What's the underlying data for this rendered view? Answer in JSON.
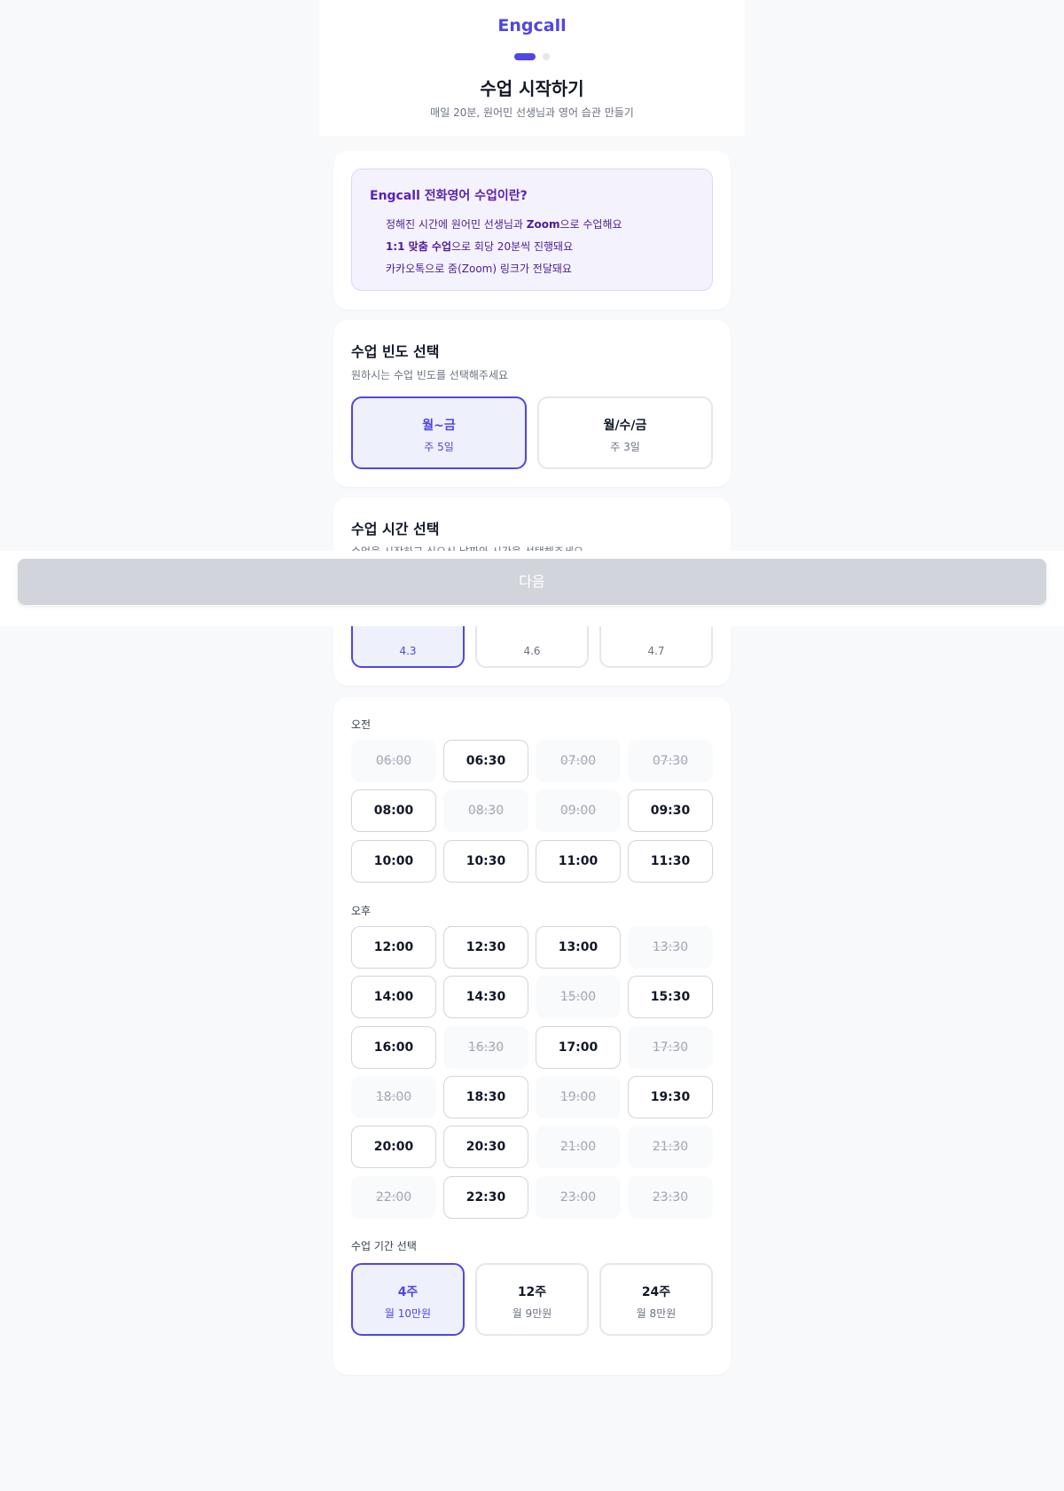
{
  "header": {
    "logo": "Engcall",
    "title": "수업 시작하기",
    "subtitle": "매일 20분, 원어민 선생님과 영어 습관 만들기"
  },
  "info": {
    "title": "Engcall 전화영어 수업이란?",
    "line1_pre": "정해진 시간에 원어민 선생님과 ",
    "line1_bold": "Zoom",
    "line1_post": "으로 수업해요",
    "line2_bold": "1:1 맞춤 수업",
    "line2_post": "으로 회당 20분씩 진행돼요",
    "line3": "카카오톡으로 줌(Zoom) 링크가 전달돼요"
  },
  "frequency": {
    "title": "수업 빈도 선택",
    "subtitle": "원하시는 수업 빈도를 선택해주세요",
    "options": [
      {
        "label": "월~금",
        "sub": "주 5일"
      },
      {
        "label": "월/수/금",
        "sub": "주 3일"
      }
    ]
  },
  "time_select": {
    "title": "수업 시간 선택",
    "subtitle": "수업을 시작하고 싶으신 날짜와 시간을 선택해주세요",
    "dates": [
      "4.3",
      "4.6",
      "4.7"
    ]
  },
  "next_button": "다음",
  "slots": {
    "am_label": "오전",
    "am": [
      "06:00",
      "06:30",
      "07:00",
      "07:30",
      "08:00",
      "08:30",
      "09:00",
      "09:30",
      "10:00",
      "10:30",
      "11:00",
      "11:30"
    ],
    "pm_label": "오후",
    "pm": [
      "12:00",
      "12:30",
      "13:00",
      "13:30",
      "14:00",
      "14:30",
      "15:00",
      "15:30",
      "16:00",
      "16:30",
      "17:00",
      "17:30",
      "18:00",
      "18:30",
      "19:00",
      "19:30",
      "20:00",
      "20:30",
      "21:00",
      "21:30",
      "22:00",
      "22:30",
      "23:00",
      "23:30"
    ]
  },
  "duration": {
    "title": "수업 기간 선택",
    "options": [
      {
        "label": "4주",
        "sub": "월 10만원"
      },
      {
        "label": "12주",
        "sub": "월 9만원"
      },
      {
        "label": "24주",
        "sub": "월 8만원"
      }
    ]
  },
  "colors": {
    "accent": "#4f46e5",
    "disabled_button": "#d1d5db"
  }
}
